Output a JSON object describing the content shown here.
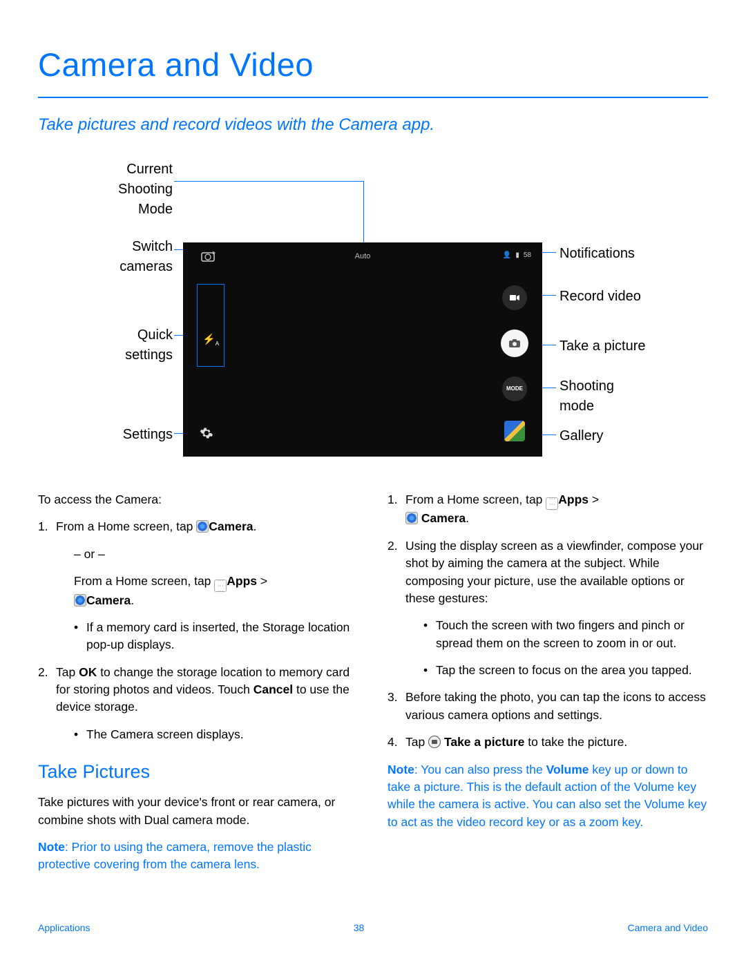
{
  "title": "Camera and Video",
  "subtitle": "Take pictures and record videos with the Camera app.",
  "diagram": {
    "labels": {
      "current_mode": "Current\nShooting\nMode",
      "switch": "Switch\ncameras",
      "quick": "Quick\nsettings",
      "settings": "Settings",
      "notifications": "Notifications",
      "record": "Record video",
      "shoot": "Take a picture",
      "shoot_mode": "Shooting\nmode",
      "gallery": "Gallery"
    },
    "phone": {
      "mode_text": "Auto",
      "battery": "58",
      "mode_btn": "MODE"
    }
  },
  "left": {
    "intro": "To access the Camera:",
    "step1_a": "From a Home screen, tap ",
    "step1_b": "Camera",
    "or": "– or –",
    "step1c_a": "From a Home screen, tap ",
    "step1c_b": "Apps",
    "step1c_c": " > ",
    "step1c_d": "Camera",
    "bullet1": "If a memory card is inserted, the Storage location pop-up displays.",
    "step2_a": "Tap ",
    "step2_b": "OK",
    "step2_c": " to change the storage location to memory card for storing photos and videos. Touch ",
    "step2_d": "Cancel",
    "step2_e": " to use the device storage.",
    "bullet2": "The Camera screen displays.",
    "h2": "Take Pictures",
    "p1": "Take pictures with your device's front or rear camera, or combine shots with Dual camera mode.",
    "note_a": "Note",
    "note_b": ": Prior to using the camera, remove the plastic protective covering from the camera lens."
  },
  "right": {
    "s1_a": "From a Home screen, tap ",
    "s1_b": "Apps",
    "s1_c": " > ",
    "s1_d": "Camera",
    "s2": "Using the display screen as a viewfinder, compose your shot by aiming the camera at the subject. While composing your picture, use the available options or these gestures:",
    "b1": "Touch the screen with two fingers and pinch or spread them on the screen to zoom in or out.",
    "b2": "Tap the screen to focus on the area you tapped.",
    "s3": "Before taking the photo, you can tap the icons to access various camera options and settings.",
    "s4_a": "Tap ",
    "s4_b": "Take a picture",
    "s4_c": " to take the picture.",
    "note_a": "Note",
    "note_b": ": You can also press the ",
    "note_c": "Volume",
    "note_d": " key up or down to take a picture. This is the default action of the Volume key while the camera is active. You can also set the Volume key to act as the video record key or as a zoom key."
  },
  "footer": {
    "left": "Applications",
    "page": "38",
    "right": "Camera and Video"
  }
}
